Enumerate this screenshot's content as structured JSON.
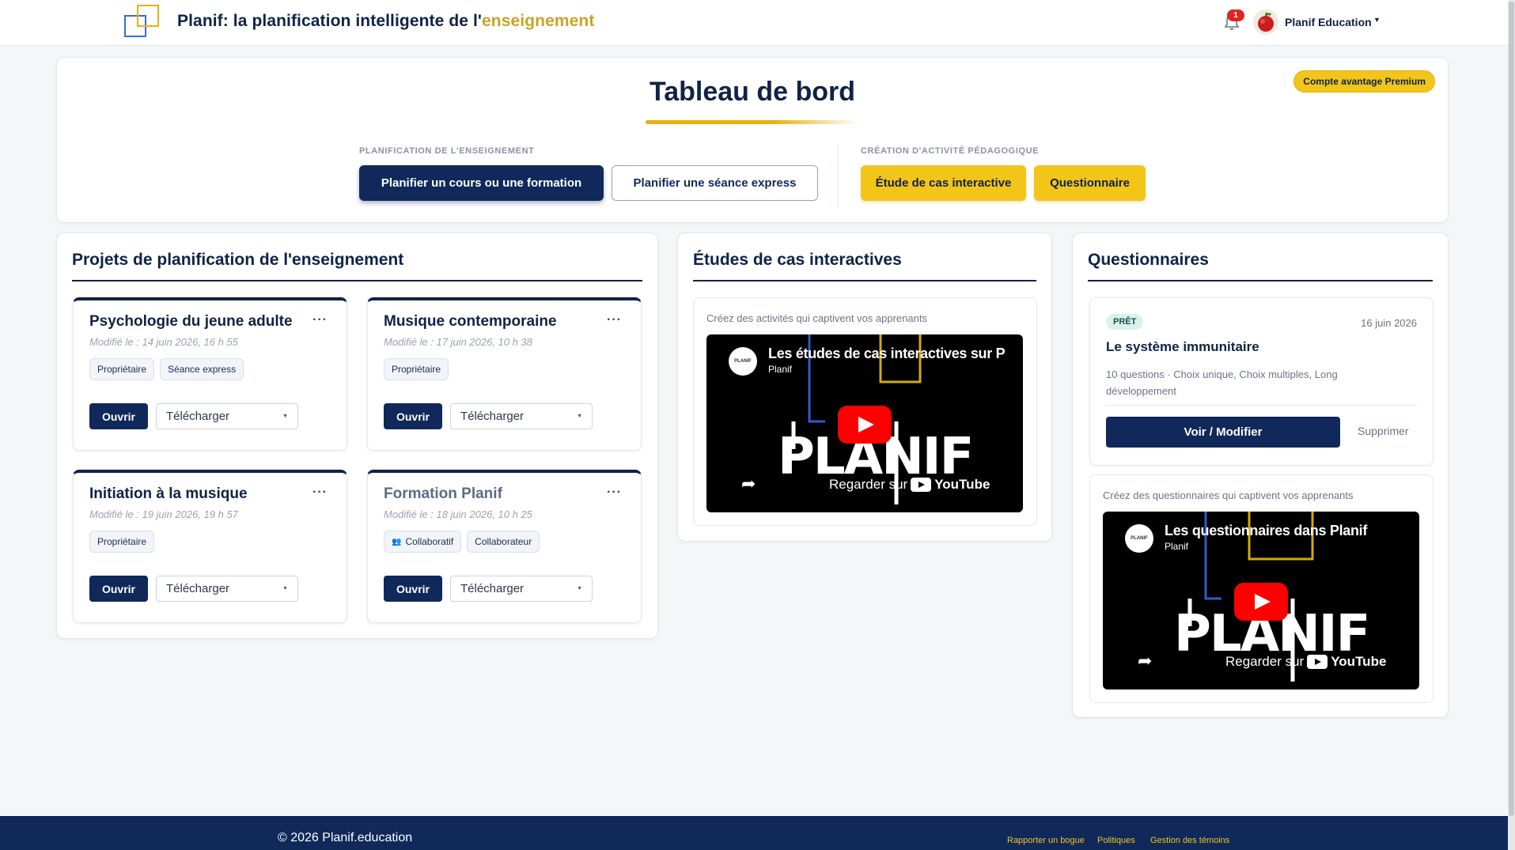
{
  "header": {
    "title_main": "Planif: la planification intelligente de l'",
    "title_accent": "enseignement",
    "notification_count": "1",
    "user_name": "Planif Education"
  },
  "hero": {
    "title": "Tableau de bord",
    "premium_badge": "Compte avantage Premium",
    "planning_label": "PLANIFICATION DE L'ENSEIGNEMENT",
    "plan_course_button": "Planifier un cours ou une formation",
    "plan_express_button": "Planifier une séance express",
    "activity_label": "CRÉATION D'ACTIVITÉ PÉDAGOGIQUE",
    "case_study_button": "Étude de cas interactive",
    "quiz_button": "Questionnaire"
  },
  "projects": {
    "title": "Projets de planification de l'enseignement",
    "items": [
      {
        "title": "Psychologie du jeune adulte",
        "modified": "Modifié le : 14 juin 2026, 16 h 55",
        "tags": [
          "Propriétaire",
          "Séance express"
        ],
        "open_label": "Ouvrir",
        "download_label": "Télécharger"
      },
      {
        "title": "Musique contemporaine",
        "modified": "Modifié le : 17 juin 2026, 10 h 38",
        "tags": [
          "Propriétaire"
        ],
        "open_label": "Ouvrir",
        "download_label": "Télécharger"
      },
      {
        "title": "Initiation à la musique",
        "modified": "Modifié le : 19 juin 2026, 19 h 57",
        "tags": [
          "Propriétaire"
        ],
        "open_label": "Ouvrir",
        "download_label": "Télécharger"
      },
      {
        "title": "Formation Planif",
        "modified": "Modifié le : 18 juin 2026, 10 h 25",
        "tags": [
          "Collaboratif",
          "Collaborateur"
        ],
        "open_label": "Ouvrir",
        "download_label": "Télécharger"
      }
    ]
  },
  "case_studies": {
    "title": "Études de cas interactives",
    "caption": "Créez des activités qui captivent vos apprenants",
    "video": {
      "title": "Les études de cas interactives sur P",
      "channel": "Planif",
      "logo": "PLANIF",
      "watch_label": "Regarder sur",
      "platform": "YouTube"
    }
  },
  "quizzes": {
    "title": "Questionnaires",
    "item": {
      "status": "PRÊT",
      "date": "16 juin 2026",
      "title": "Le système immunitaire",
      "meta": "10 questions · Choix unique, Choix multiples, Long développement",
      "view_label": "Voir / Modifier",
      "delete_label": "Supprimer"
    },
    "caption": "Créez des questionnaires qui captivent vos apprenants",
    "video": {
      "title": "Les questionnaires dans Planif",
      "channel": "Planif",
      "logo": "PLANIF",
      "watch_label": "Regarder sur",
      "platform": "YouTube"
    }
  },
  "footer": {
    "copyright": "© 2026 Planif.education",
    "links": [
      "Rapporter un bogue",
      "Politiques",
      "Gestion des témoins"
    ]
  },
  "colors": {
    "navy": "#10295a",
    "yellow": "#f2c518",
    "accent_gold": "#c9a32a"
  }
}
